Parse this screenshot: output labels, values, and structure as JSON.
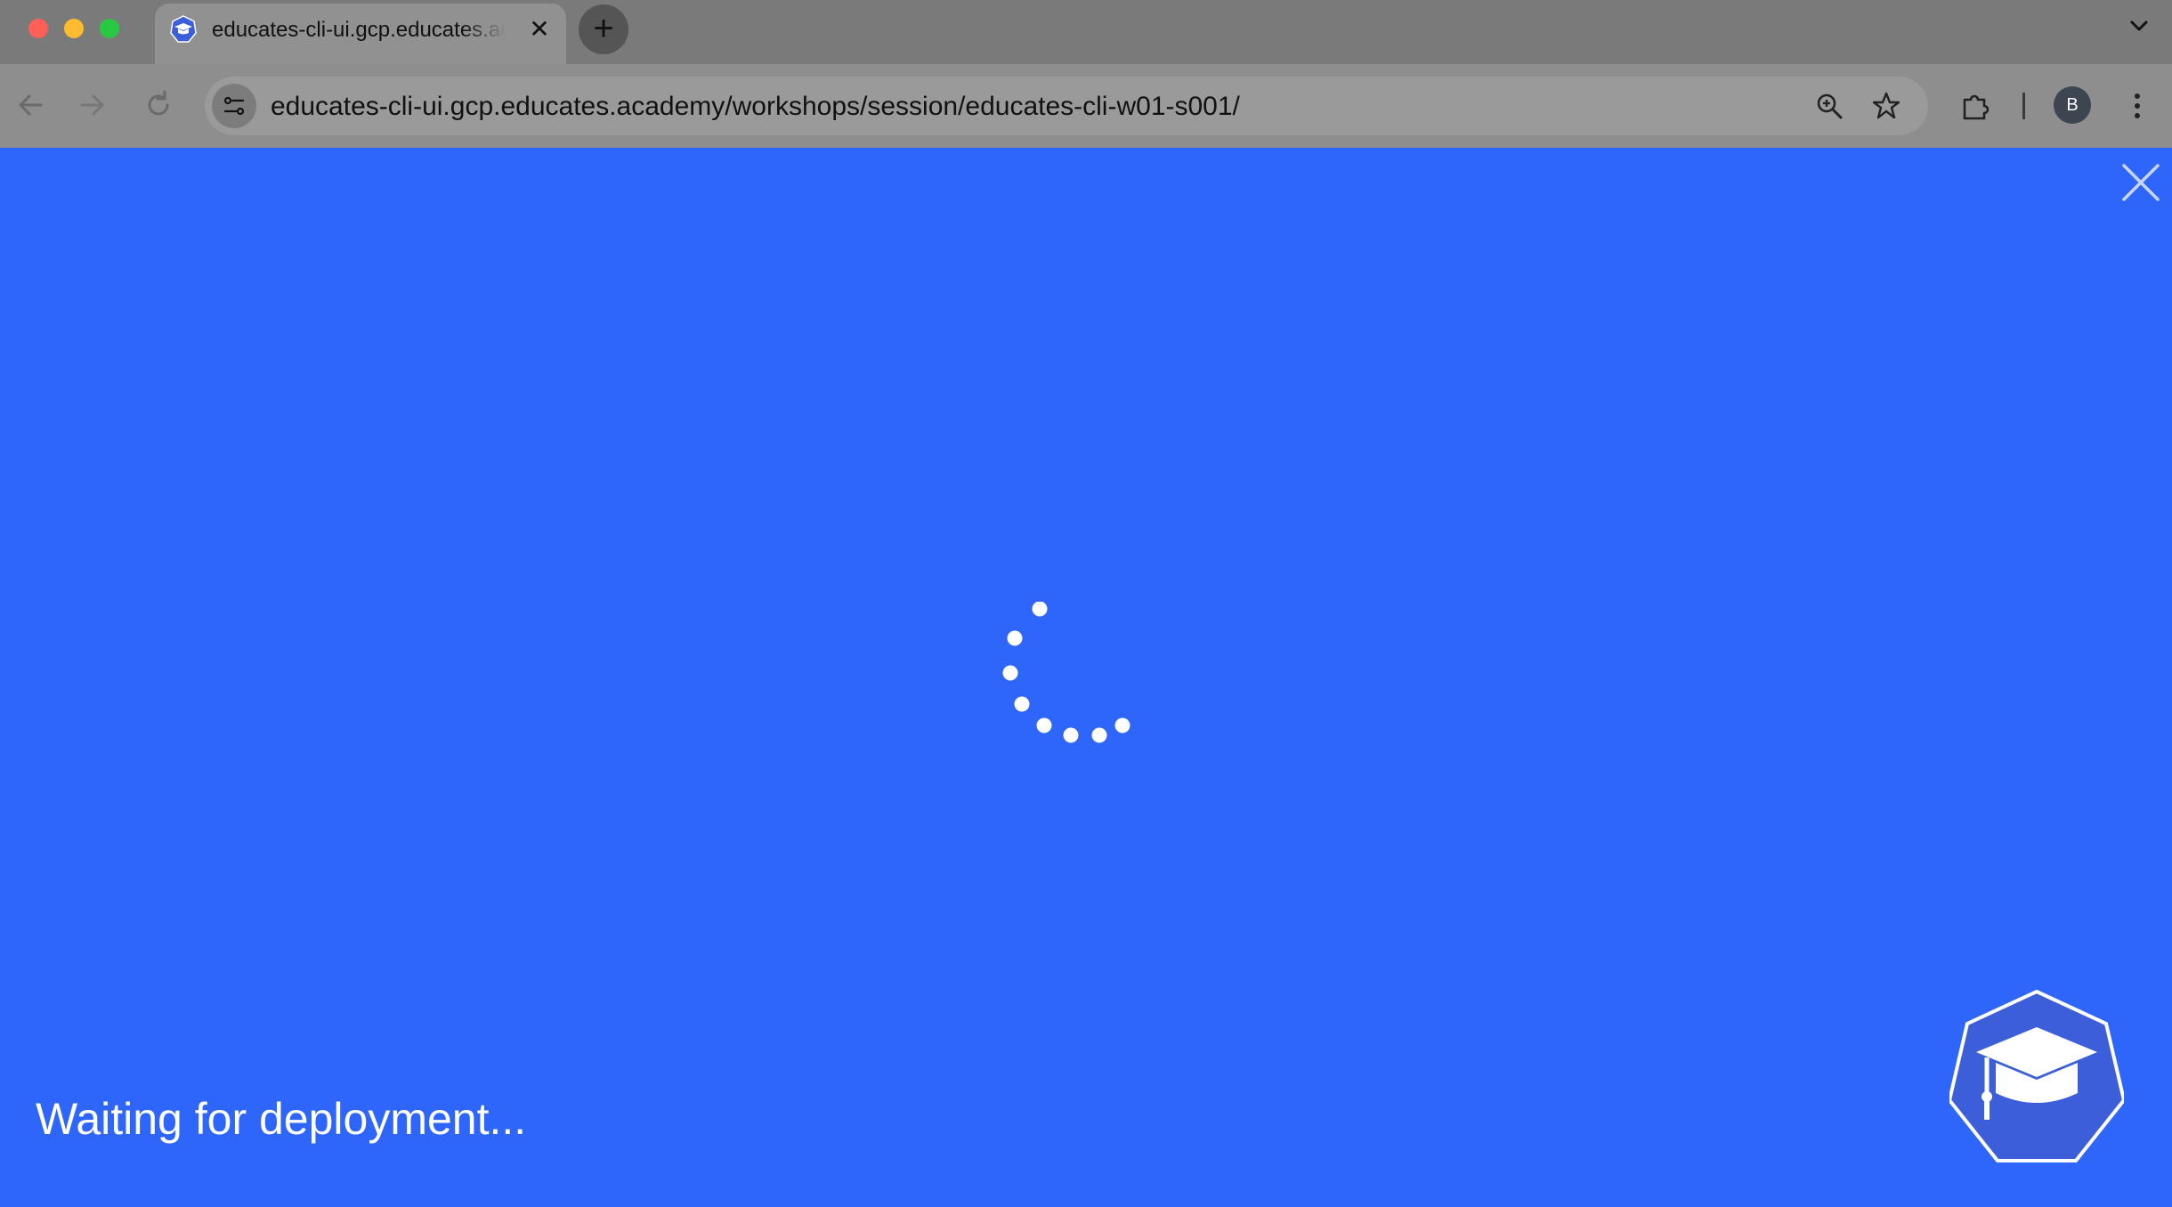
{
  "browser": {
    "tab": {
      "title": "educates-cli-ui.gcp.educates.academy",
      "favicon": "graduation-cap-hexagon-icon",
      "close_glyph": "✕"
    },
    "new_tab_glyph": "+",
    "address_bar": {
      "url": "educates-cli-ui.gcp.educates.academy/workshops/session/educates-cli-w01-s001/"
    },
    "profile_initial": "B",
    "icons": [
      "back-arrow-icon",
      "forward-arrow-icon",
      "reload-icon",
      "site-settings-icon",
      "zoom-icon",
      "bookmark-star-icon",
      "extensions-puzzle-icon",
      "more-vert-icon",
      "tab-search-chevron-icon"
    ]
  },
  "page": {
    "status_message": "Waiting for deployment...",
    "background_color": "#2e66fb",
    "accent_color": "#ffffff",
    "logo_color": "#3c5fd9",
    "icons": [
      "close-icon",
      "loading-spinner-icon",
      "educates-logo-icon"
    ]
  }
}
